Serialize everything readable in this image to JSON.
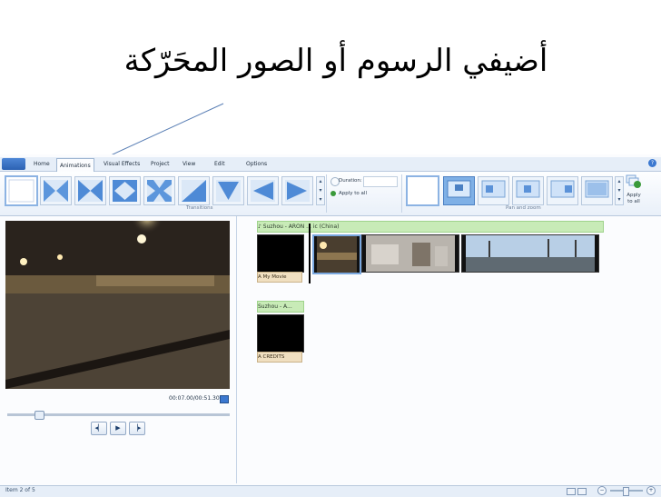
{
  "heading": "أضيفي الرسوم أو الصور المحَرّكة",
  "tabs": [
    "Home",
    "Animations",
    "Visual Effects",
    "Project",
    "View",
    "Edit",
    "Options"
  ],
  "active_tab": "Animations",
  "ribbon": {
    "transitions_label": "Transitions",
    "duration_label": "Duration:",
    "apply_to_all": "Apply to all",
    "pan_zoom_label": "Pan and zoom",
    "apply_to_all_pz": "Apply to all"
  },
  "player": {
    "time": "00:07.00/00:51.30"
  },
  "storyboard": {
    "music": "Suzhou - ARON ... ic (China)",
    "caption1": "My Movie",
    "music2": "Suzhou - A...",
    "caption2": "CREDITS"
  },
  "status": {
    "text": "Item 2 of 5"
  },
  "colors": {
    "ribbon_bg": "#e9f0f9",
    "music_bar": "#c8ebb7",
    "caption_bar": "#f0dfc0",
    "accent": "#3b78d0"
  }
}
